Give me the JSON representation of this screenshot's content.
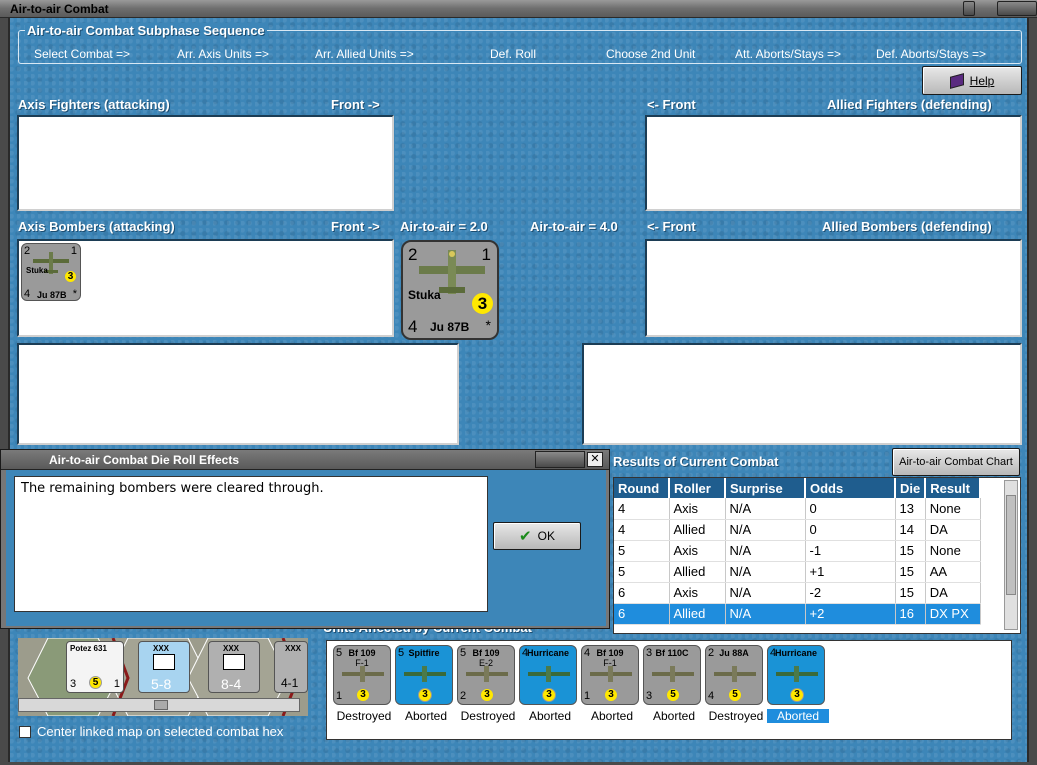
{
  "window": {
    "title": "Air-to-air Combat"
  },
  "sequence": {
    "title": "Air-to-air Combat Subphase Sequence",
    "steps": [
      "Select Combat =>",
      "Arr. Axis Units =>",
      "Arr. Allied Units =>",
      "Def. Roll",
      "Choose 2nd Unit",
      "Att. Aborts/Stays =>",
      "Def. Aborts/Stays =>"
    ]
  },
  "help_button": "Help",
  "labels": {
    "axis_fighters": "Axis Fighters (attacking)",
    "allied_fighters": "Allied Fighters (defending)",
    "axis_bombers": "Axis Bombers (attacking)",
    "allied_bombers": "Allied Bombers (defending)",
    "front_right": "Front ->",
    "front_left": "<- Front",
    "axis_air_to_air": "Air-to-air = 2.0",
    "allied_air_to_air": "Air-to-air = 4.0"
  },
  "selected_unit": {
    "name": "Stuka",
    "type": "Ju 87B",
    "top_left": "2",
    "top_right": "1",
    "bottom_left": "4",
    "circle": "3",
    "star": "*"
  },
  "dialog": {
    "title": "Air-to-air Combat Die Roll Effects",
    "message": "The remaining bombers were cleared through.",
    "ok_label": "OK"
  },
  "results": {
    "title": "Results of Current Combat",
    "chart_button": "Air-to-air Combat Chart",
    "columns": [
      "Round",
      "Roller",
      "Surprise",
      "Odds",
      "Die",
      "Result"
    ],
    "rows": [
      [
        "4",
        "Axis",
        "N/A",
        "0",
        "13",
        "None"
      ],
      [
        "4",
        "Allied",
        "N/A",
        "0",
        "14",
        "DA"
      ],
      [
        "5",
        "Axis",
        "N/A",
        "-1",
        "15",
        "None"
      ],
      [
        "5",
        "Allied",
        "N/A",
        "+1",
        "15",
        "AA"
      ],
      [
        "6",
        "Axis",
        "N/A",
        "-2",
        "15",
        "DA"
      ],
      [
        "6",
        "Allied",
        "N/A",
        "+2",
        "16",
        "DX PX"
      ]
    ],
    "selected_row": 5
  },
  "affected": {
    "title": "Units Affected by Current Combat",
    "units": [
      {
        "name": "Bf 109",
        "sub": "F-1",
        "tl": "5",
        "bl": "1",
        "circle": "3",
        "status": "Destroyed",
        "color": "gray"
      },
      {
        "name": "Spitfire",
        "sub": "",
        "tl": "5",
        "bl": "",
        "circle": "3",
        "status": "Aborted",
        "color": "blue"
      },
      {
        "name": "Bf 109",
        "sub": "E-2",
        "tl": "5",
        "bl": "2",
        "circle": "3",
        "status": "Destroyed",
        "color": "gray"
      },
      {
        "name": "Hurricane",
        "sub": "",
        "tl": "4",
        "bl": "",
        "circle": "3",
        "status": "Aborted",
        "color": "blue"
      },
      {
        "name": "Bf 109",
        "sub": "F-1",
        "tl": "4",
        "bl": "1",
        "circle": "3",
        "status": "Aborted",
        "color": "gray"
      },
      {
        "name": "Bf 110C",
        "sub": "",
        "tl": "3",
        "bl": "3",
        "circle": "5",
        "status": "Aborted",
        "color": "gray"
      },
      {
        "name": "Ju 88A",
        "sub": "",
        "tl": "2",
        "bl": "4",
        "circle": "5",
        "status": "Destroyed",
        "color": "gray"
      },
      {
        "name": "Hurricane",
        "sub": "",
        "tl": "4",
        "bl": "",
        "circle": "3",
        "status": "Aborted",
        "color": "blue"
      }
    ],
    "selected_unit": 7
  },
  "center_map_checkbox": "Center linked map on selected combat hex",
  "minimap": {
    "counters": [
      {
        "name": "Potez 631",
        "bl": "3",
        "circle": "5",
        "br": "1"
      },
      {
        "name": "XXX",
        "value": "5-8"
      },
      {
        "name": "XXX",
        "value": "8-4"
      },
      {
        "name": "XXX",
        "value": "4-1"
      }
    ]
  },
  "colors": {
    "panel_blue": "#3d86b8",
    "selected_blue": "#1f8ddd",
    "header_blue": "#1f5d8e"
  }
}
